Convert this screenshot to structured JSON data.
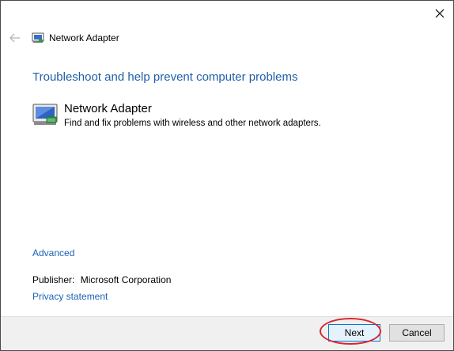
{
  "window": {
    "title": "Network Adapter"
  },
  "main": {
    "heading": "Troubleshoot and help prevent computer problems",
    "item": {
      "title": "Network Adapter",
      "description": "Find and fix problems with wireless and other network adapters."
    },
    "advanced_link": "Advanced",
    "publisher_label": "Publisher:",
    "publisher_value": "Microsoft Corporation",
    "privacy_link": "Privacy statement"
  },
  "footer": {
    "next_label": "Next",
    "cancel_label": "Cancel"
  },
  "icons": {
    "back": "back-arrow-icon",
    "close": "close-icon",
    "adapter": "network-adapter-icon"
  },
  "colors": {
    "heading": "#1f5fa8",
    "link": "#1a63b7",
    "highlight": "#d9262b"
  }
}
